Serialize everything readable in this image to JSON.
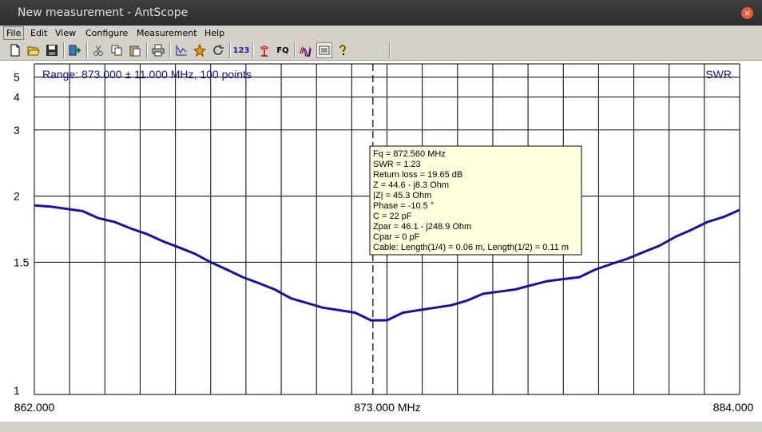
{
  "window": {
    "title": "New measurement - AntScope",
    "close_glyph": "×"
  },
  "menu": [
    {
      "label": "File"
    },
    {
      "label": "Edit"
    },
    {
      "label": "View"
    },
    {
      "label": "Configure"
    },
    {
      "label": "Measurement"
    },
    {
      "label": "Help"
    }
  ],
  "toolbar": {
    "count_label": "123",
    "fq_label": "FQ"
  },
  "chart_data": {
    "type": "line",
    "title": "Range: 873.000 ± 11.000 MHz, 100 points",
    "parameter_label": "SWR",
    "xlim": [
      862.0,
      884.0
    ],
    "x_tick_labels": [
      "862.000",
      "873.000 MHz",
      "884.000"
    ],
    "y_ticks": [
      1,
      1.5,
      2,
      3,
      4,
      5
    ],
    "y_tick_labels": [
      "1",
      "1.5",
      "2",
      "3",
      "4",
      "5"
    ],
    "y_scale": "1 - 1/SWR",
    "grid": true,
    "series_color": "#1414a0",
    "cursor_x": 872.56,
    "series": [
      {
        "x": [
          862.0,
          862.5,
          863.0,
          863.5,
          864.0,
          864.5,
          865.0,
          865.5,
          866.0,
          866.5,
          867.0,
          867.5,
          868.0,
          868.5,
          869.0,
          869.5,
          870.0,
          870.5,
          871.0,
          871.5,
          872.0,
          872.5,
          873.0,
          873.5,
          874.0,
          874.5,
          875.0,
          875.5,
          876.0,
          876.5,
          877.0,
          877.5,
          878.0,
          878.5,
          879.0,
          879.5,
          880.0,
          880.5,
          881.0,
          881.5,
          882.0,
          882.5,
          883.0,
          883.5,
          884.0
        ],
        "y": [
          1.91,
          1.9,
          1.88,
          1.86,
          1.8,
          1.77,
          1.72,
          1.68,
          1.63,
          1.59,
          1.55,
          1.5,
          1.46,
          1.42,
          1.39,
          1.36,
          1.32,
          1.3,
          1.28,
          1.27,
          1.26,
          1.23,
          1.23,
          1.26,
          1.27,
          1.28,
          1.29,
          1.31,
          1.34,
          1.35,
          1.36,
          1.38,
          1.4,
          1.41,
          1.42,
          1.46,
          1.49,
          1.52,
          1.56,
          1.6,
          1.66,
          1.71,
          1.77,
          1.81,
          1.87
        ]
      }
    ],
    "tooltip": [
      "Fq = 872.560 MHz",
      "SWR = 1.23",
      "Return loss = 19.65 dB",
      "Z = 44.6 - j8.3 Ohm",
      "|Z| = 45.3 Ohm",
      "Phase = -10.5 °",
      "C = 22 pF",
      "Zpar = 46.1 - j248.9 Ohm",
      "Cpar = 0 pF",
      "Cable: Length(1/4) = 0.06 m, Length(1/2) = 0.11 m"
    ]
  }
}
